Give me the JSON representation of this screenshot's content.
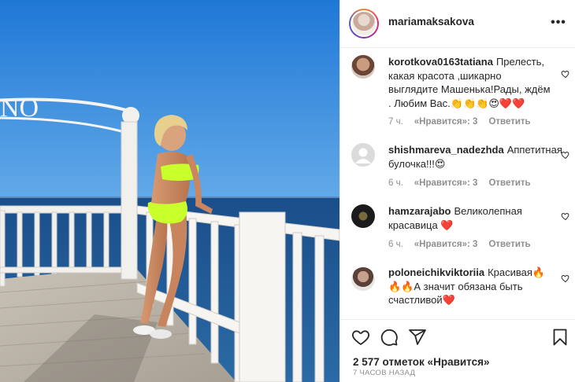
{
  "post": {
    "username": "mariamaksakova",
    "more_label": "•••",
    "likes_text": "2 577 отметок «Нравится»",
    "time_text": "7 ЧАСОВ НАЗАД"
  },
  "photo": {
    "sign_text": "NO"
  },
  "comments": [
    {
      "user": "korotkova0163tatiana",
      "text": "Прелесть, какая красота ,шикарно выглядите Машенька!Рады, ждём . Любим Вас.👏👏👏😍❤️❤️",
      "time": "7 ч.",
      "likes": "«Нравится»: 3",
      "reply": "Ответить"
    },
    {
      "user": "shishmareva_nadezhda",
      "text": "Аппетитная булочка!!!😍",
      "time": "6 ч.",
      "likes": "«Нравится»: 3",
      "reply": "Ответить"
    },
    {
      "user": "hamzarajabo",
      "text": "Великолепная красавица ❤️",
      "time": "6 ч.",
      "likes": "«Нравится»: 3",
      "reply": "Ответить"
    },
    {
      "user": "poloneichikviktoriia",
      "text": "Красивая🔥🔥🔥А значит обязана быть счастливой❤️",
      "time": "",
      "likes": "",
      "reply": ""
    }
  ],
  "icons": {
    "like": "heart-outline-icon",
    "comment": "comment-bubble-icon",
    "share": "paper-plane-icon",
    "save": "bookmark-icon",
    "more": "ellipsis-icon",
    "comment_like": "small-heart-icon"
  },
  "colors": {
    "accent_text": "#262626",
    "meta_text": "#8e8e8e",
    "divider": "#efefef",
    "sky": "#2f86d8",
    "sea": "#1f4f86",
    "bikini": "#c9ff2a"
  }
}
